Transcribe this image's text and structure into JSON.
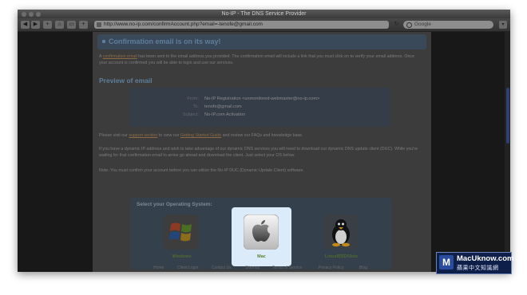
{
  "window": {
    "title": "No-IP - The DNS Service Provider"
  },
  "toolbar": {
    "url": "http://www.no-ip.com/confirmAccount.php?email=-tenofe@gmail.com",
    "search_placeholder": "Google",
    "reload_glyph": "↻"
  },
  "banner": {
    "title": "Confirmation email is on its way!"
  },
  "intro": {
    "link": "confirmation email",
    "text_before": "A ",
    "text_after": " has been sent to the email address you provided. The confirmation email will include a link that you must click on to verify your email address. Once your account is confirmed you will be able to login and use our services."
  },
  "preview": {
    "heading": "Preview of email",
    "rows": [
      {
        "label": "From:",
        "value": "No-IP Registration <unmonitored-webmaster@no-ip.com>"
      },
      {
        "label": "To:",
        "value": "tenofe@gmail.com"
      },
      {
        "label": "Subject:",
        "value": "No-IP.com Activation"
      }
    ]
  },
  "body": {
    "p1_before": "Please visit our ",
    "p1_link1": "support section",
    "p1_mid": " to view our ",
    "p1_link2": "Getting Started Guide",
    "p1_after": " and review our FAQs and knowledge base.",
    "p2": "If you have a dynamic IP address and wish to take advantage of our dynamic DNS services you will need to download our dynamic DNS update client (DUC). While you're waiting for that confirmation email to arrive go ahead and download the client. Just select your OS below.",
    "p3": "Note: You must confirm your account before you can utilize the No-IP DUC (Dynamic Update Client) software."
  },
  "os": {
    "title": "Select your Operating System:",
    "options": [
      {
        "label": "Windows",
        "icon": "windows-logo-icon",
        "selected": false
      },
      {
        "label": "Mac",
        "icon": "apple-logo-icon",
        "selected": true
      },
      {
        "label": "Linux/BSD/Unix",
        "icon": "tux-penguin-icon",
        "selected": false
      }
    ]
  },
  "footer": {
    "links": [
      "Home",
      "Client Login",
      "Contact Us",
      "Sitemap",
      "Terms of Service",
      "Privacy Policy",
      "Blog"
    ]
  },
  "watermark": {
    "title": "MacUknow.com",
    "subtitle": "蘋果中文知識網",
    "logo": "M"
  },
  "colors": {
    "highlight_tile": "#dcebfa",
    "heading_blue": "#5e7e9a",
    "link_brown": "#8a6a46"
  }
}
